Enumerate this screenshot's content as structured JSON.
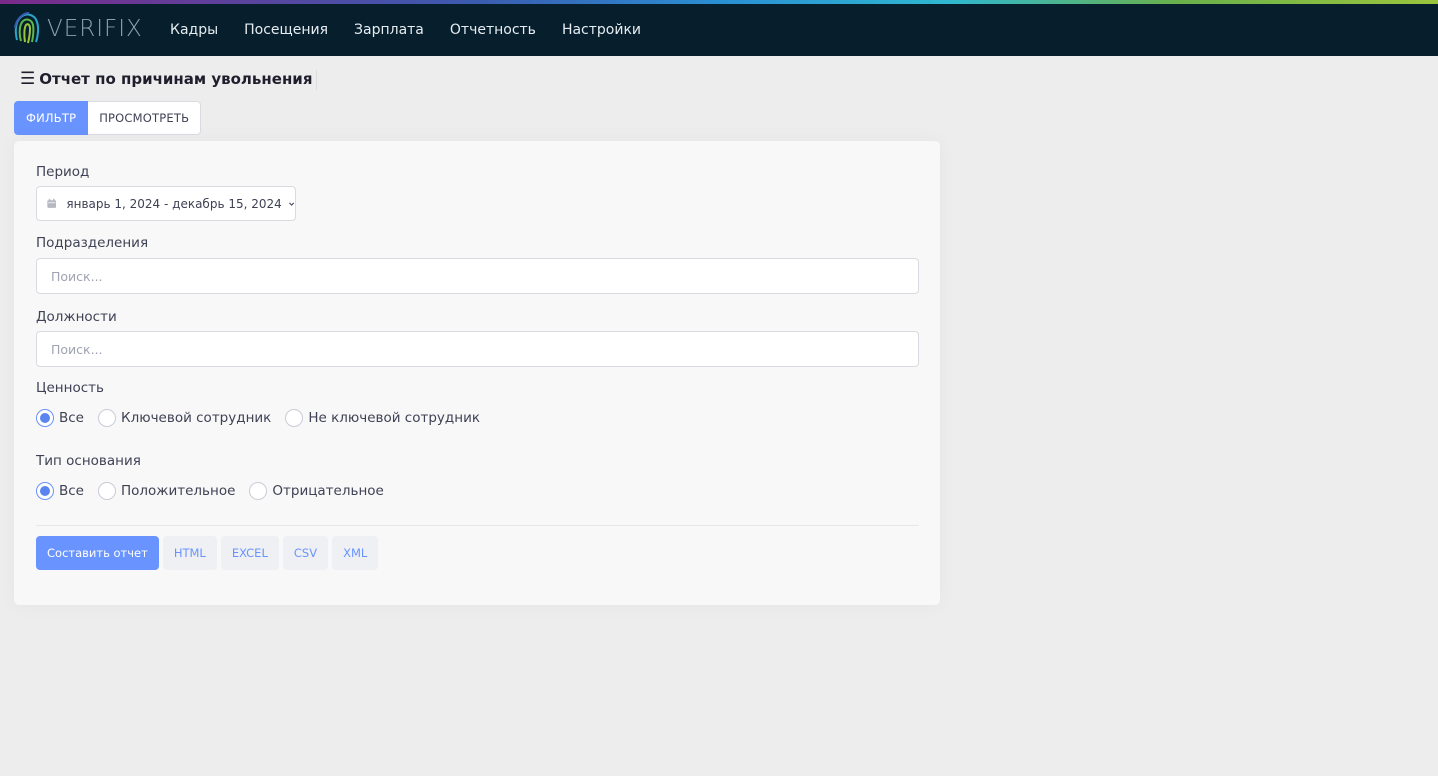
{
  "app": {
    "brand": "VERIFIX"
  },
  "nav": {
    "items": [
      {
        "label": "Кадры"
      },
      {
        "label": "Посещения"
      },
      {
        "label": "Зарплата"
      },
      {
        "label": "Отчетность"
      },
      {
        "label": "Настройки"
      }
    ]
  },
  "page": {
    "title": "Отчет по причинам увольнения"
  },
  "tabs": [
    {
      "label": "ФИЛЬТР",
      "active": true
    },
    {
      "label": "ПРОСМОТРЕТЬ",
      "active": false
    }
  ],
  "form": {
    "period": {
      "label": "Период",
      "value": "январь 1, 2024 - декабрь 15, 2024",
      "icon": "calendar-icon"
    },
    "divisions": {
      "label": "Подразделения",
      "placeholder": "Поиск...",
      "value": ""
    },
    "positions": {
      "label": "Должности",
      "placeholder": "Поиск...",
      "value": ""
    },
    "value_group": {
      "label": "Ценность",
      "options": [
        {
          "label": "Все",
          "checked": true
        },
        {
          "label": "Ключевой сотрудник",
          "checked": false
        },
        {
          "label": "Не ключевой сотрудник",
          "checked": false
        }
      ]
    },
    "basis_type": {
      "label": "Тип основания",
      "options": [
        {
          "label": "Все",
          "checked": true
        },
        {
          "label": "Положительное",
          "checked": false
        },
        {
          "label": "Отрицательное",
          "checked": false
        }
      ]
    }
  },
  "actions": {
    "build_label": "Составить отчет",
    "formats": [
      "HTML",
      "EXCEL",
      "CSV",
      "XML"
    ]
  },
  "colors": {
    "navbar": "#071e2c",
    "primary": "#6993ff",
    "background": "#ededed"
  }
}
